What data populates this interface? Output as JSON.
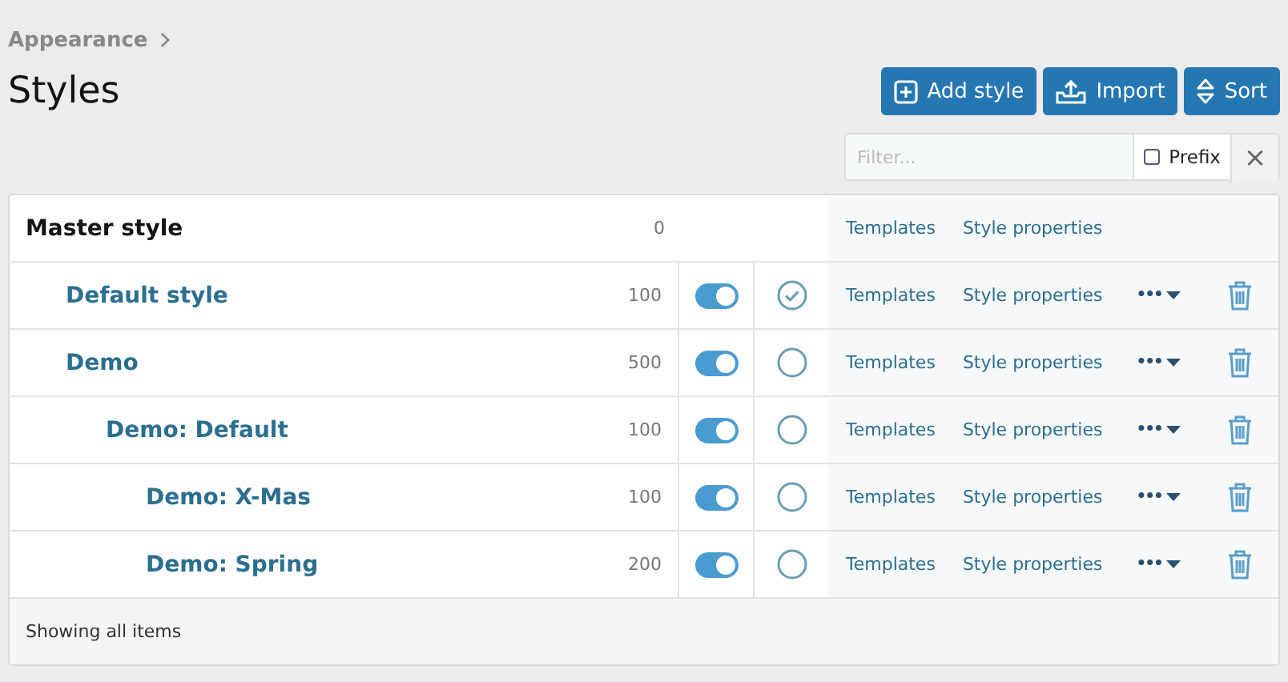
{
  "breadcrumb": [
    "Appearance"
  ],
  "title": "Styles",
  "buttons": [
    {
      "kind": "add",
      "label": "Add style"
    },
    {
      "kind": "import",
      "label": "Import"
    },
    {
      "kind": "sort",
      "label": "Sort"
    }
  ],
  "filter": {
    "placeholder": "Filter...",
    "prefix_label": "Prefix",
    "prefix_checked": false,
    "clear": "×"
  },
  "styles": [
    {
      "kind": "master",
      "name": "Master style",
      "count": "0",
      "links": [
        "Templates",
        "Style properties"
      ],
      "children": [
        {
          "kind": "style",
          "name": "Default style",
          "count": "100",
          "enabled": true,
          "default": true,
          "links": [
            "Templates",
            "Style properties"
          ],
          "menu": "•••"
        },
        {
          "kind": "style",
          "name": "Demo",
          "count": "500",
          "enabled": true,
          "default": false,
          "links": [
            "Templates",
            "Style properties"
          ],
          "menu": "•••",
          "children": [
            {
              "kind": "style",
              "name": "Demo: Default",
              "count": "100",
              "enabled": true,
              "default": false,
              "links": [
                "Templates",
                "Style properties"
              ],
              "menu": "•••",
              "children": [
                {
                  "kind": "style",
                  "name": "Demo: X-Mas",
                  "count": "100",
                  "enabled": true,
                  "default": false,
                  "links": [
                    "Templates",
                    "Style properties"
                  ],
                  "menu": "•••"
                },
                {
                  "kind": "style",
                  "name": "Demo: Spring",
                  "count": "200",
                  "enabled": true,
                  "default": false,
                  "links": [
                    "Templates",
                    "Style properties"
                  ],
                  "menu": "•••"
                }
              ]
            }
          ]
        }
      ]
    }
  ],
  "footer": "Showing all items"
}
